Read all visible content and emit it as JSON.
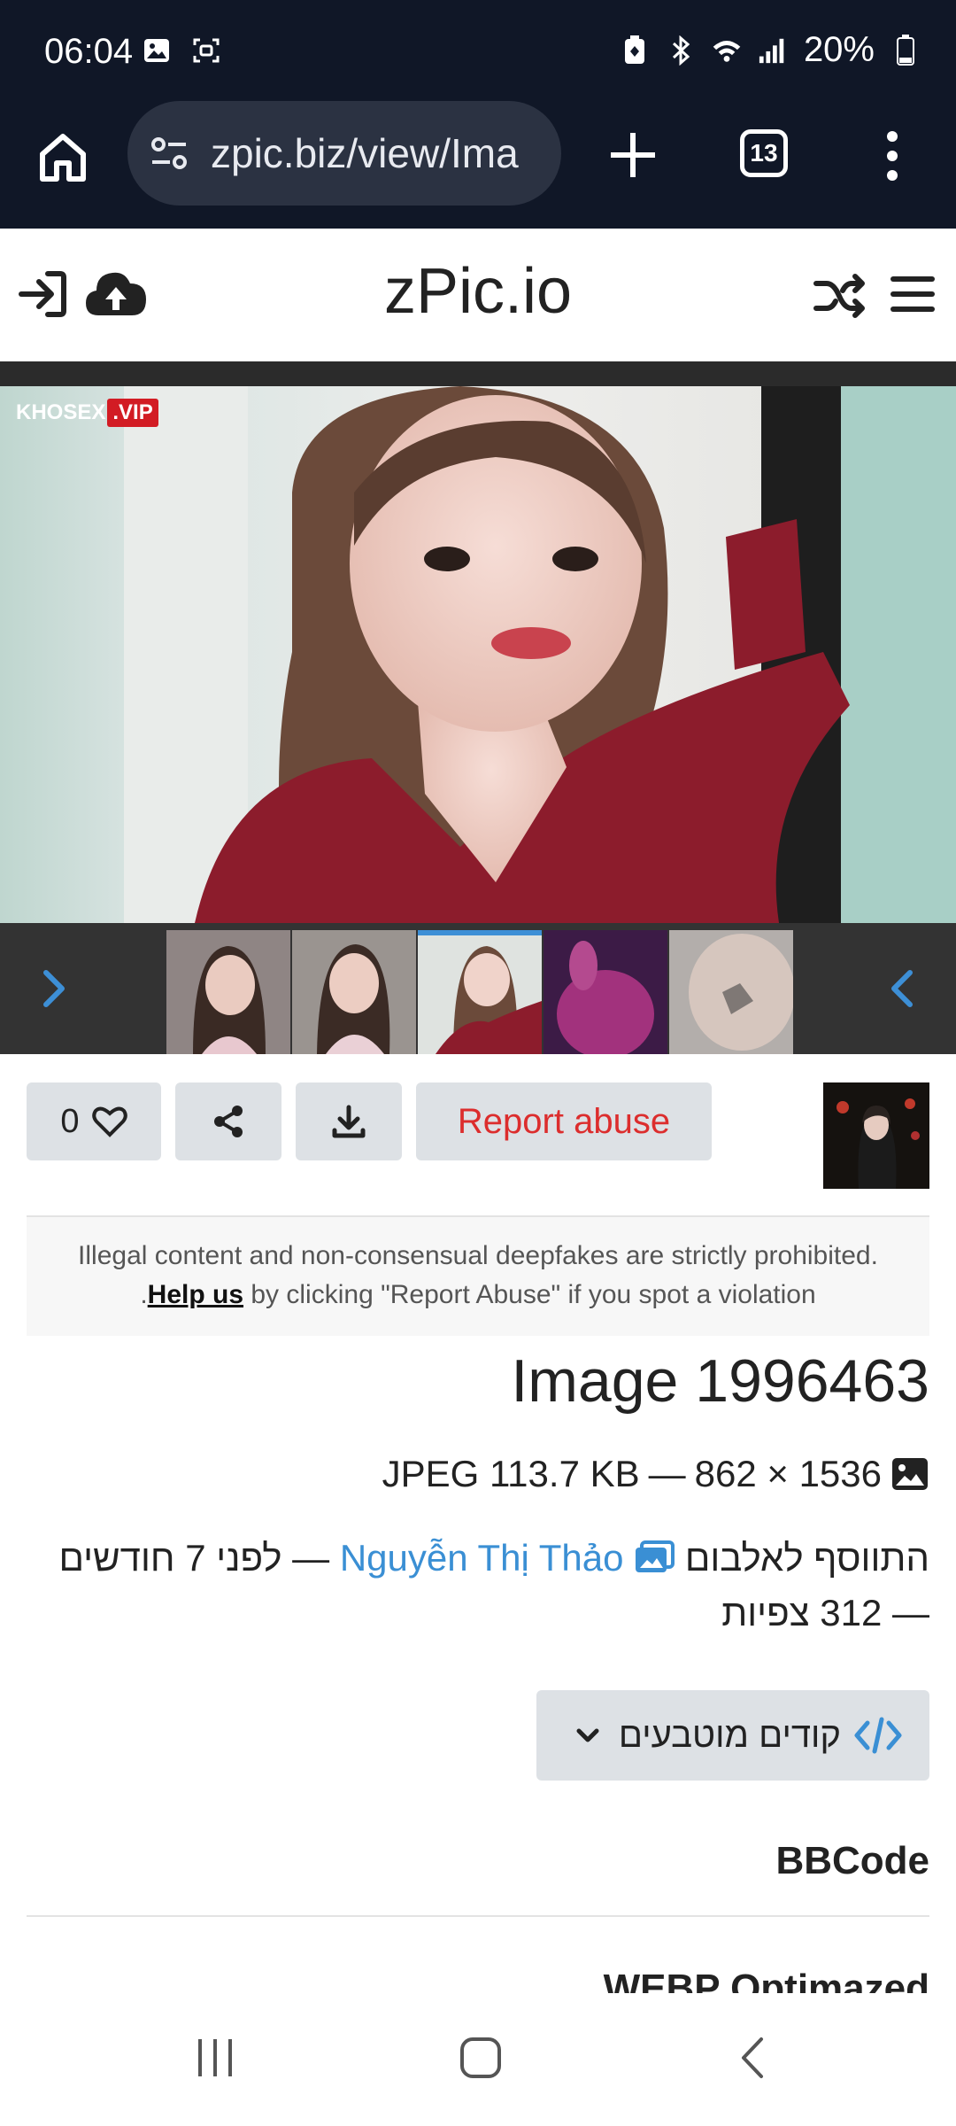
{
  "status_bar": {
    "time": "06:04",
    "battery": "20%",
    "icons": [
      "gallery-icon",
      "screen-record-icon",
      "battery-saver-icon",
      "bluetooth-icon",
      "wifi-icon",
      "signal-icon",
      "battery-icon"
    ]
  },
  "browser": {
    "url": "zpic.biz/view/Ima",
    "tab_count": "13"
  },
  "site": {
    "title": "zPic.io"
  },
  "viewer": {
    "watermark_main": "KHOSEX",
    "watermark_badge": ".VIP",
    "active_thumb_index": 2
  },
  "actions": {
    "like_count": "0",
    "report_label": "Report abuse"
  },
  "notice": {
    "line1": "Illegal content and non-consensual deepfakes are strictly prohibited.",
    "help_link": "Help us",
    "line2_rest": " by clicking \"Report Abuse\" if you spot a violation",
    "line2_lead": "."
  },
  "image_info": {
    "title": "Image 1996463",
    "format_size": "JPEG 113.7 KB",
    "dims_sep": " — ",
    "dimensions": "862 × 1536",
    "added_prefix": "התווסף לאלבום",
    "album_name": "Nguyễn Thị Thảo",
    "time_ago": "— לפני 7 חודשים",
    "views": "— 312 צפיות"
  },
  "embed": {
    "button_label": "קודים מוטבעים",
    "bbcode_label": "BBCode",
    "webp_label": "WEBP Optimazed"
  },
  "colors": {
    "accent_blue": "#3a8fd4",
    "report_red": "#dc2d2d",
    "status_bg": "#101727"
  }
}
